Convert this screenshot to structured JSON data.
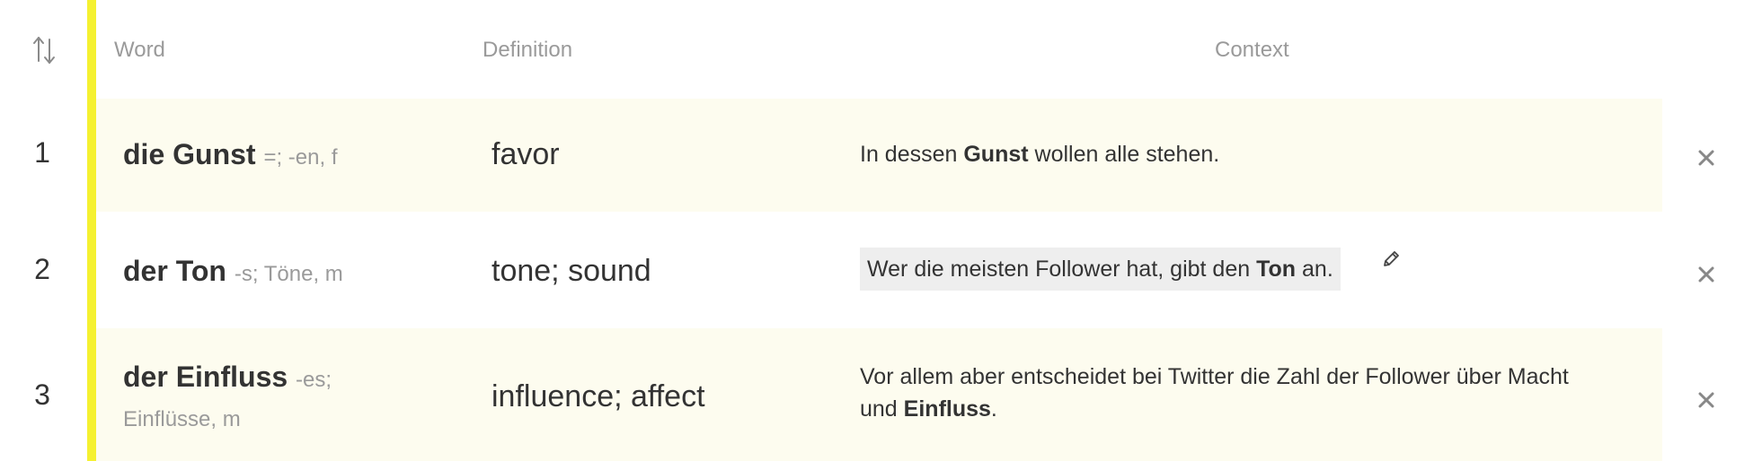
{
  "colors": {
    "accent_bar": "#f5f130",
    "row_highlight": "#fdfcef",
    "context_edit_bg": "#eeeeee",
    "muted_text": "#9a9a9a"
  },
  "header": {
    "sort_icon": "sort-arrows-icon",
    "word_label": "Word",
    "definition_label": "Definition",
    "context_label": "Context"
  },
  "rows": [
    {
      "number": "1",
      "word": "die Gunst",
      "grammar": "=; -en, f",
      "definition": "favor",
      "context_before": "In dessen ",
      "context_bold": "Gunst",
      "context_after": " wollen alle stehen.",
      "highlighted": true
    },
    {
      "number": "2",
      "word": "der Ton",
      "grammar": "-s; Töne, m",
      "definition": "tone; sound",
      "context_before": "Wer die meisten Follower hat, gibt den ",
      "context_bold": "Ton",
      "context_after": " an.",
      "highlighted": false,
      "editing": true
    },
    {
      "number": "3",
      "word": "der Einfluss",
      "grammar_line1": "-es;",
      "grammar_line2": "Einflüsse, m",
      "definition": "influence; affect",
      "context_line1": "Vor allem aber entscheidet bei Twitter die Zahl der Follower über Macht",
      "context_line2_before": "und ",
      "context_bold": "Einfluss",
      "context_after": ".",
      "highlighted": true
    }
  ]
}
